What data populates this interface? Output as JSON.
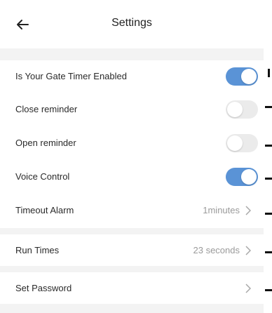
{
  "header": {
    "title": "Settings",
    "back_icon": "arrow-left-icon"
  },
  "settings": [
    {
      "label": "Is Your Gate Timer Enabled",
      "control": "toggle",
      "enabled": true
    },
    {
      "label": "Close reminder",
      "control": "toggle",
      "enabled": false
    },
    {
      "label": "Open reminder",
      "control": "toggle",
      "enabled": false
    },
    {
      "label": "Voice Control",
      "control": "toggle",
      "enabled": true
    },
    {
      "label": "Timeout Alarm",
      "control": "link",
      "value": "1minutes"
    }
  ],
  "run_times": {
    "label": "Run Times",
    "value": "23 seconds"
  },
  "password": {
    "label": "Set Password"
  },
  "colors": {
    "toggle_on": "#5a93d6",
    "toggle_off": "#ebebeb",
    "section_gap": "#f3f3f3",
    "secondary_text": "#9a9a9a"
  }
}
